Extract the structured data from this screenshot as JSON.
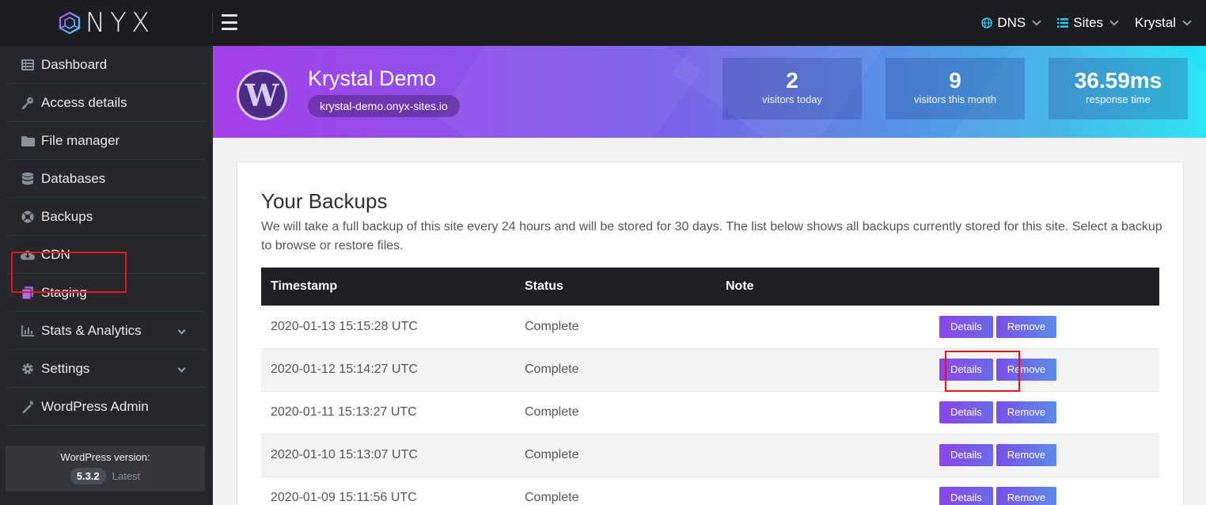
{
  "app": {
    "logo_text": "NYX"
  },
  "topnav": {
    "dns_label": "DNS",
    "sites_label": "Sites",
    "user_label": "Krystal"
  },
  "sidebar": {
    "items": [
      {
        "label": "Dashboard",
        "icon": "dashboard-icon"
      },
      {
        "label": "Access details",
        "icon": "key-icon"
      },
      {
        "label": "File manager",
        "icon": "folder-icon"
      },
      {
        "label": "Databases",
        "icon": "database-icon"
      },
      {
        "label": "Backups",
        "icon": "backup-icon"
      },
      {
        "label": "CDN",
        "icon": "cloud-icon"
      },
      {
        "label": "Staging",
        "icon": "staging-icon"
      },
      {
        "label": "Stats & Analytics",
        "icon": "chart-icon"
      },
      {
        "label": "Settings",
        "icon": "gear-icon"
      },
      {
        "label": "WordPress Admin",
        "icon": "wrench-icon"
      }
    ],
    "version_label": "WordPress version:",
    "version_number": "5.3.2",
    "version_status": "Latest"
  },
  "hero": {
    "site_title": "Krystal Demo",
    "site_domain": "krystal-demo.onyx-sites.io",
    "stats": [
      {
        "value": "2",
        "label": "visitors today"
      },
      {
        "value": "9",
        "label": "visitors this month"
      },
      {
        "value": "36.59ms",
        "label": "response time"
      }
    ]
  },
  "backups": {
    "title": "Your Backups",
    "description": "We will take a full backup of this site every 24 hours and will be stored for 30 days. The list below shows all backups currently stored for this site. Select a backup to browse or restore files.",
    "columns": {
      "timestamp": "Timestamp",
      "status": "Status",
      "note": "Note"
    },
    "details_label": "Details",
    "remove_label": "Remove",
    "rows": [
      {
        "timestamp": "2020-01-13 15:15:28 UTC",
        "status": "Complete",
        "note": ""
      },
      {
        "timestamp": "2020-01-12 15:14:27 UTC",
        "status": "Complete",
        "note": ""
      },
      {
        "timestamp": "2020-01-11 15:13:27 UTC",
        "status": "Complete",
        "note": ""
      },
      {
        "timestamp": "2020-01-10 15:13:07 UTC",
        "status": "Complete",
        "note": ""
      },
      {
        "timestamp": "2020-01-09 15:11:56 UTC",
        "status": "Complete",
        "note": ""
      }
    ]
  },
  "colors": {
    "accent_purple": "#8c45ea",
    "accent_blue": "#5a8ce9",
    "highlight_red": "#e3161d"
  }
}
